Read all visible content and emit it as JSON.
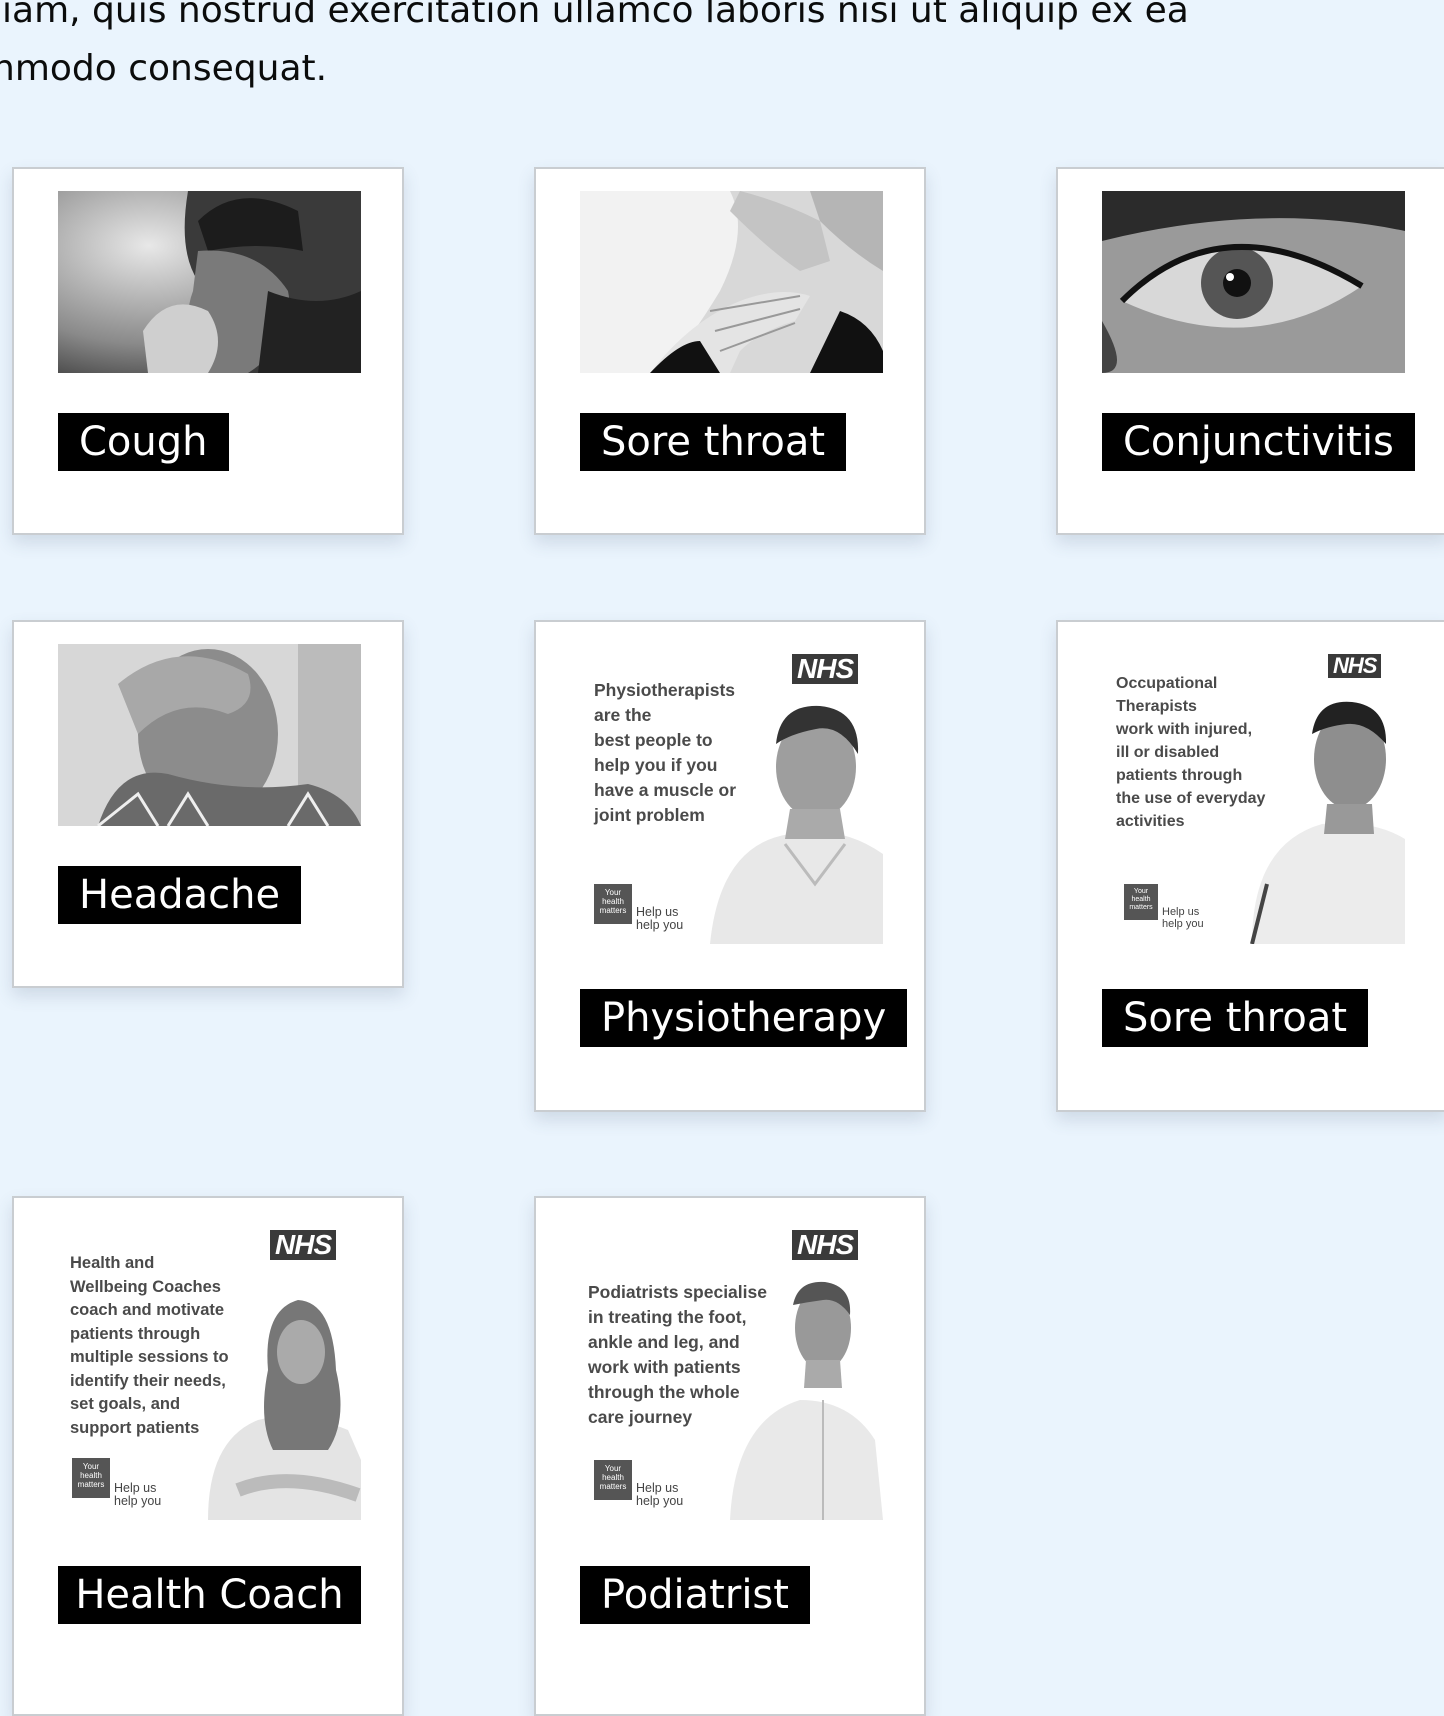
{
  "intro": {
    "line1": "liam, quis nostrud exercitation ullamco laboris nisi ut aliquip ex ea",
    "line2": "nmodo consequat."
  },
  "cards": [
    {
      "label": "Cough",
      "image_icon": "man-coughing-photo"
    },
    {
      "label": "Sore throat",
      "image_icon": "woman-holding-throat-photo"
    },
    {
      "label": "Conjunctivitis",
      "image_icon": "red-eye-photo"
    },
    {
      "label": "Headache",
      "image_icon": "man-with-headache-photo"
    },
    {
      "label": "Physiotherapy",
      "poster": {
        "logo": "NHS",
        "text": "Physiotherapists\nare the\nbest people to\nhelp you if you\nhave a muscle or\njoint problem",
        "badge": "Your\nhealth\nmatters",
        "tagline": "Help us\nhelp you"
      }
    },
    {
      "label": "Sore throat",
      "poster": {
        "logo": "NHS",
        "text": "Occupational\nTherapists\nwork with injured,\nill or disabled\npatients through\nthe use of everyday\nactivities",
        "badge": "Your\nhealth\nmatters",
        "tagline": "Help us\nhelp you"
      }
    },
    {
      "label": "Health Coach",
      "poster": {
        "logo": "NHS",
        "text": "Health and\nWellbeing Coaches\ncoach and motivate\npatients through\nmultiple sessions to\nidentify their needs,\nset goals, and\nsupport patients",
        "badge": "Your\nhealth\nmatters",
        "tagline": "Help us\nhelp you"
      }
    },
    {
      "label": "Podiatrist",
      "poster": {
        "logo": "NHS",
        "text": "Podiatrists specialise\nin treating the foot,\nankle and leg, and\nwork with patients\nthrough the whole\ncare journey",
        "badge": "Your\nhealth\nmatters",
        "tagline": "Help us\nhelp you"
      }
    }
  ]
}
